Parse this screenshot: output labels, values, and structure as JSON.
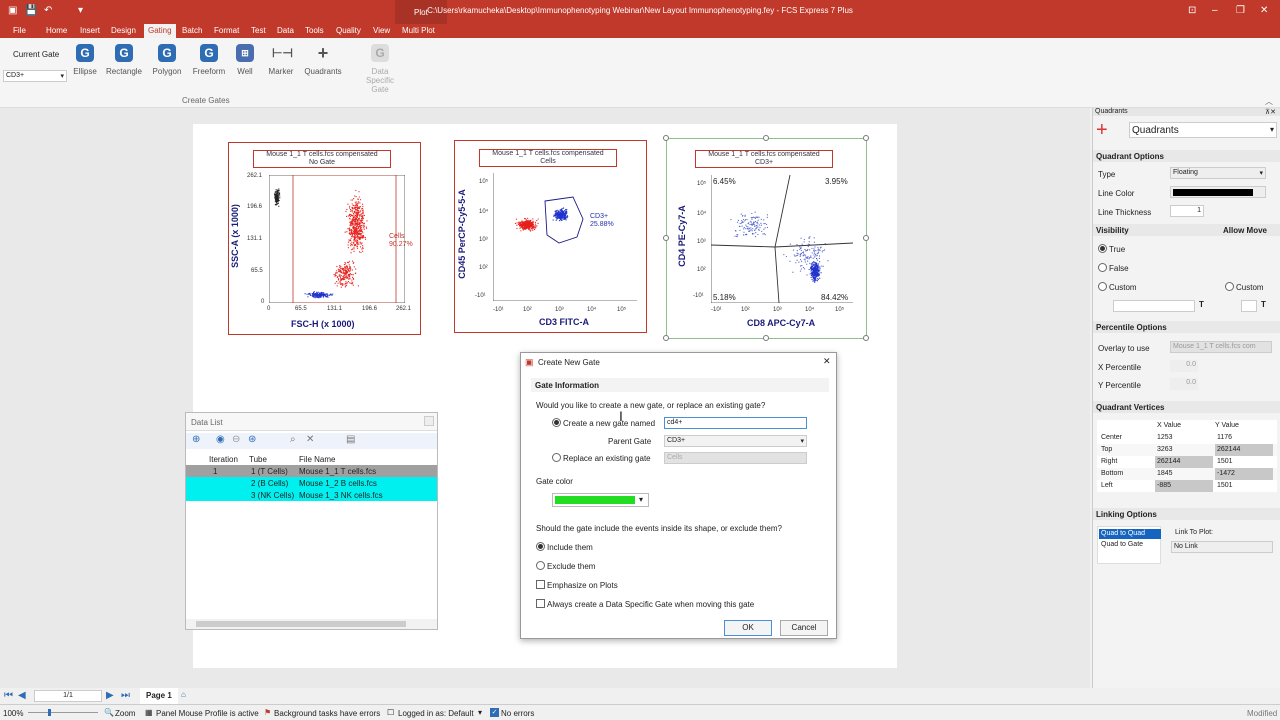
{
  "window": {
    "title": "C:\\Users\\rkamucheka\\Desktop\\Immunophenotyping Webinar\\New Layout Immunophenotyping.fey - FCS Express 7 Plus"
  },
  "context_tab": {
    "group": "Plot",
    "tab": "Multi Plot"
  },
  "menu": [
    "File",
    "Home",
    "Insert",
    "Design",
    "Gating",
    "Batch",
    "Format",
    "Test",
    "Data",
    "Tools",
    "Quality",
    "View"
  ],
  "ribbon": {
    "current_gate_label": "Current Gate",
    "current_gate_value": "CD3+",
    "buttons": [
      "Ellipse",
      "Rectangle",
      "Polygon",
      "Freeform",
      "Well",
      "Marker",
      "Quadrants"
    ],
    "disabled_button": "Data Specific Gate",
    "group_label": "Create Gates"
  },
  "plots": [
    {
      "title1": "Mouse 1_1 T cells.fcs compensated",
      "title2": "No Gate",
      "xlabel": "FSC-H (x 1000)",
      "ylabel": "SSC-A (x 1000)",
      "xticks": [
        "0",
        "65.5",
        "131.1",
        "196.6",
        "262.1"
      ],
      "yticks": [
        "262.1",
        "196.6",
        "131.1",
        "65.5",
        "0"
      ],
      "gate_label": "Cells",
      "gate_value": "90.27%"
    },
    {
      "title1": "Mouse 1_1 T cells.fcs compensated",
      "title2": "Cells",
      "xlabel": "CD3 FITC-A",
      "ylabel": "CD45 PerCP-Cy5-5-A",
      "xticks": [
        "-10¹",
        "10²",
        "10³",
        "10⁴",
        "10⁵"
      ],
      "yticks": [
        "10⁵",
        "10⁴",
        "10³",
        "10²",
        "-10¹"
      ],
      "gate_label": "CD3+",
      "gate_value": "25.88%"
    },
    {
      "title1": "Mouse 1_1 T cells.fcs compensated",
      "title2": "CD3+",
      "xlabel": "CD8 APC-Cy7-A",
      "ylabel": "CD4 PE-Cy7-A",
      "xticks": [
        "-10¹",
        "10²",
        "10³",
        "10⁴",
        "10⁵"
      ],
      "yticks": [
        "10⁵",
        "10⁴",
        "10³",
        "10²",
        "-10¹"
      ],
      "q_ul": "6.45%",
      "q_ur": "3.95%",
      "q_ll": "5.18%",
      "q_lr": "84.42%"
    }
  ],
  "data_list": {
    "title": "Data List",
    "headers": [
      "Iteration",
      "Tube",
      "File Name"
    ],
    "rows": [
      {
        "iteration": "1",
        "tube": "1 (T Cells)",
        "file": "Mouse 1_1 T cells.fcs"
      },
      {
        "iteration": "",
        "tube": "2 (B Cells)",
        "file": "Mouse 1_2 B cells.fcs"
      },
      {
        "iteration": "",
        "tube": "3 (NK Cells)",
        "file": "Mouse 1_3 NK cells.fcs"
      }
    ]
  },
  "dialog": {
    "title": "Create New Gate",
    "section": "Gate Information",
    "question": "Would you like to create a new gate, or replace an existing gate?",
    "opt_create": "Create a new gate named",
    "gate_name": "cd4+",
    "parent_label": "Parent Gate",
    "parent_value": "CD3+",
    "opt_replace": "Replace an existing gate",
    "replace_value": "Cells",
    "color_label": "Gate color",
    "gate_color": "#22dd22",
    "include_q": "Should the gate include the events inside its shape, or exclude them?",
    "include": "Include them",
    "exclude": "Exclude them",
    "emphasize": "Emphasize on Plots",
    "always": "Always create a Data Specific Gate when moving this gate",
    "ok": "OK",
    "cancel": "Cancel"
  },
  "panel": {
    "header": "Quadrants",
    "tool": "Quadrants",
    "quad_options": "Quadrant Options",
    "type_label": "Type",
    "type_value": "Floating",
    "line_color_label": "Line Color",
    "line_thickness_label": "Line Thickness",
    "line_thickness": "1",
    "visibility": "Visibility",
    "allow_move": "Allow Move",
    "vis_true": "True",
    "vis_false": "False",
    "vis_custom": "Custom",
    "vis_custom2": "Custom",
    "percentile_options": "Percentile Options",
    "overlay_label": "Overlay to use",
    "overlay_value": "Mouse 1_1 T cells.fcs com",
    "xp_label": "X Percentile",
    "xp": "0.0",
    "yp_label": "Y Percentile",
    "yp": "0.0",
    "vertices": "Quadrant Vertices",
    "vheaders": [
      "X Value",
      "Y Value"
    ],
    "vrows": [
      {
        "name": "Center",
        "x": "1253",
        "y": "1176"
      },
      {
        "name": "Top",
        "x": "3263",
        "y": "262144"
      },
      {
        "name": "Right",
        "x": "262144",
        "y": "1501"
      },
      {
        "name": "Bottom",
        "x": "1845",
        "y": "-1472"
      },
      {
        "name": "Left",
        "x": "-885",
        "y": "1501"
      }
    ],
    "linking": "Linking Options",
    "link_items": [
      "Quad to Quad",
      "Quad to Gate"
    ],
    "link_to_plot": "Link To Plot:",
    "link_value": "No Link"
  },
  "status": {
    "zoom": "100%",
    "page_count": "1/1",
    "page_tab": "Page 1",
    "zoom_label": "Zoom",
    "profile": "Panel Mouse Profile is active",
    "errors": "Background tasks have errors",
    "login": "Logged in as: Default",
    "noerrors": "No errors",
    "modified": "Modified"
  }
}
